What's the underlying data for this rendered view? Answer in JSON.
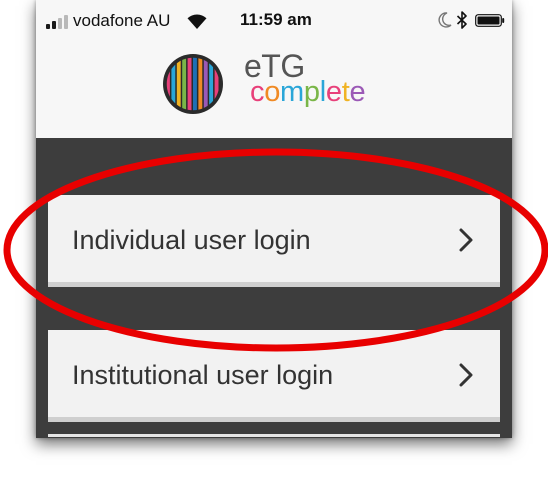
{
  "status_bar": {
    "carrier": "vodafone AU",
    "time": "11:59 am"
  },
  "brand": {
    "name_line1": "eTG",
    "name_line2": [
      "c",
      "o",
      "m",
      "p",
      "l",
      "e",
      "t",
      "e"
    ],
    "name_line2_colors": [
      "#e8407a",
      "#f08a24",
      "#2aa6d8",
      "#7ab648",
      "#2aa6d8",
      "#e8407a",
      "#f0b323",
      "#9b59b6"
    ],
    "logo_stripe_colors": [
      "#e8407a",
      "#2aa6d8",
      "#f0b323",
      "#7ab648",
      "#e8407a",
      "#1f6fb5",
      "#f08a24",
      "#9b59b6",
      "#2aa6d8",
      "#e8407a"
    ]
  },
  "login": {
    "individual_label": "Individual user login",
    "institutional_label": "Institutional user login"
  },
  "icons": {
    "signal": "signal-bars-icon",
    "wifi": "wifi-icon",
    "moon": "do-not-disturb-moon-icon",
    "bluetooth": "bluetooth-icon",
    "battery": "battery-icon",
    "chevron": "chevron-right-icon"
  },
  "colors": {
    "dark_panel": "#3d3d3d",
    "button_bg": "#f2f2f2",
    "annotation": "#e80000"
  }
}
